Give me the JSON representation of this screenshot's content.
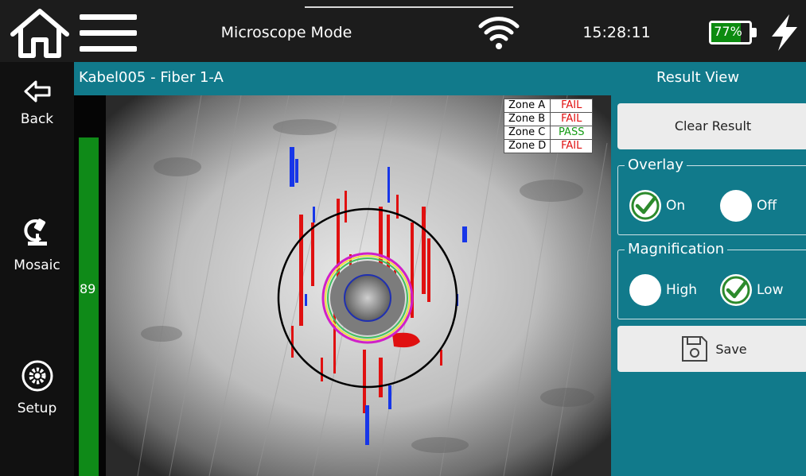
{
  "topbar": {
    "title": "Microscope Mode",
    "time": "15:28:11",
    "battery": "77%",
    "battery_level": 0.77,
    "icons": [
      "home-icon",
      "menu-icon",
      "wifi-icon",
      "battery-icon",
      "charging-bolt-icon"
    ]
  },
  "nav": {
    "back": "Back",
    "mosaic": "Mosaic",
    "setup": "Setup"
  },
  "header": {
    "fiber": "Kabel005 - Fiber 1-A",
    "view": "Result View"
  },
  "score": {
    "value": "89",
    "level": 0.89
  },
  "zones": [
    {
      "zone": "Zone A",
      "result": "FAIL"
    },
    {
      "zone": "Zone B",
      "result": "FAIL"
    },
    {
      "zone": "Zone C",
      "result": "PASS"
    },
    {
      "zone": "Zone D",
      "result": "FAIL"
    }
  ],
  "panel": {
    "clear_result": "Clear Result",
    "overlay": {
      "title": "Overlay",
      "on": "On",
      "off": "Off",
      "selected": "On"
    },
    "magnification": {
      "title": "Magnification",
      "high": "High",
      "low": "Low",
      "selected": "Low"
    },
    "save": "Save"
  },
  "colors": {
    "accent": "#117a8b",
    "pass": "#129a12",
    "fail": "#e01010",
    "score_fill": "#0f8a18"
  }
}
